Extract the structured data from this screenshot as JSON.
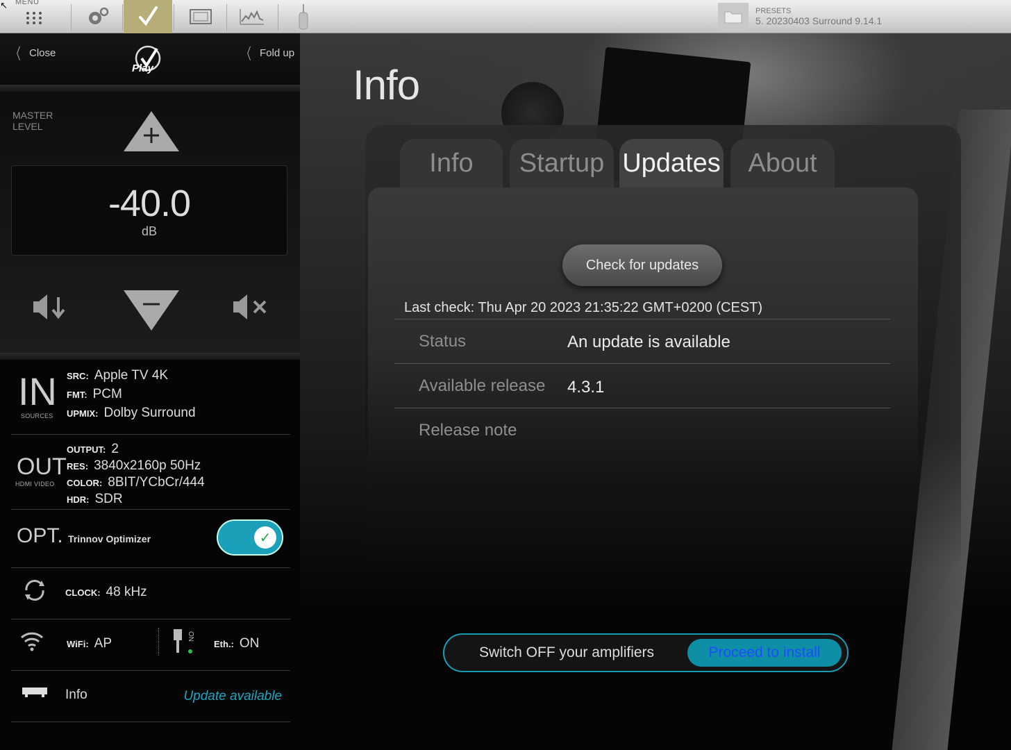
{
  "toolbar": {
    "menu_label": "MENU",
    "icons": [
      "grid-icon",
      "gear-icon",
      "check-icon",
      "screen-icon",
      "graph-icon",
      "mic-icon"
    ],
    "active_tab": "check-icon",
    "presets_label": "PRESETS",
    "presets_value": "5. 20230403 Surround 9.14.1"
  },
  "left_panel": {
    "close_label": "Close",
    "fold_label": "Fold up",
    "logo_text": "Play",
    "master_label_line1": "MASTER",
    "master_label_line2": "LEVEL",
    "volume_value": "-40.0",
    "volume_unit": "dB",
    "input": {
      "big": "IN",
      "caption": "SOURCES",
      "src_key": "SRC:",
      "src_val": "Apple TV 4K",
      "fmt_key": "FMT:",
      "fmt_val": "PCM",
      "upmix_key": "UPMIX:",
      "upmix_val": "Dolby Surround"
    },
    "output": {
      "big": "OUT",
      "caption": "HDMI VIDEO",
      "output_key": "OUTPUT:",
      "output_val": "2",
      "res_key": "RES:",
      "res_val": "3840x2160p 50Hz",
      "color_key": "COLOR:",
      "color_val": "8BIT/YCbCr/444",
      "hdr_key": "HDR:",
      "hdr_val": "SDR"
    },
    "optimizer": {
      "big": "OPT.",
      "label": "Trinnov Optimizer",
      "enabled": true
    },
    "clock": {
      "key": "CLOCK:",
      "val": "48 kHz"
    },
    "network": {
      "wifi_key": "WiFi:",
      "wifi_val": "AP",
      "eth_key": "Eth.:",
      "eth_val": "ON",
      "eth_badge": "ON"
    },
    "info": {
      "label": "Info",
      "status": "Update available"
    }
  },
  "main": {
    "title": "Info",
    "tabs": [
      {
        "label": "Info"
      },
      {
        "label": "Startup"
      },
      {
        "label": "Updates"
      },
      {
        "label": "About"
      }
    ],
    "active_tab": "Updates",
    "check_button": "Check for updates",
    "last_check": "Last check: Thu Apr 20 2023 21:35:22 GMT+0200 (CEST)",
    "rows": [
      {
        "label": "Status",
        "value": "An update is available"
      },
      {
        "label": "Available release",
        "value": "4.3.1"
      },
      {
        "label": "Release note",
        "value": ""
      }
    ],
    "install_message": "Switch OFF your amplifiers",
    "install_button": "Proceed to install"
  },
  "colors": {
    "accent": "#1aa0b8",
    "toolbar_active": "#b7ad78",
    "link": "#19a7c0",
    "install_button_text": "#1d4cff"
  }
}
